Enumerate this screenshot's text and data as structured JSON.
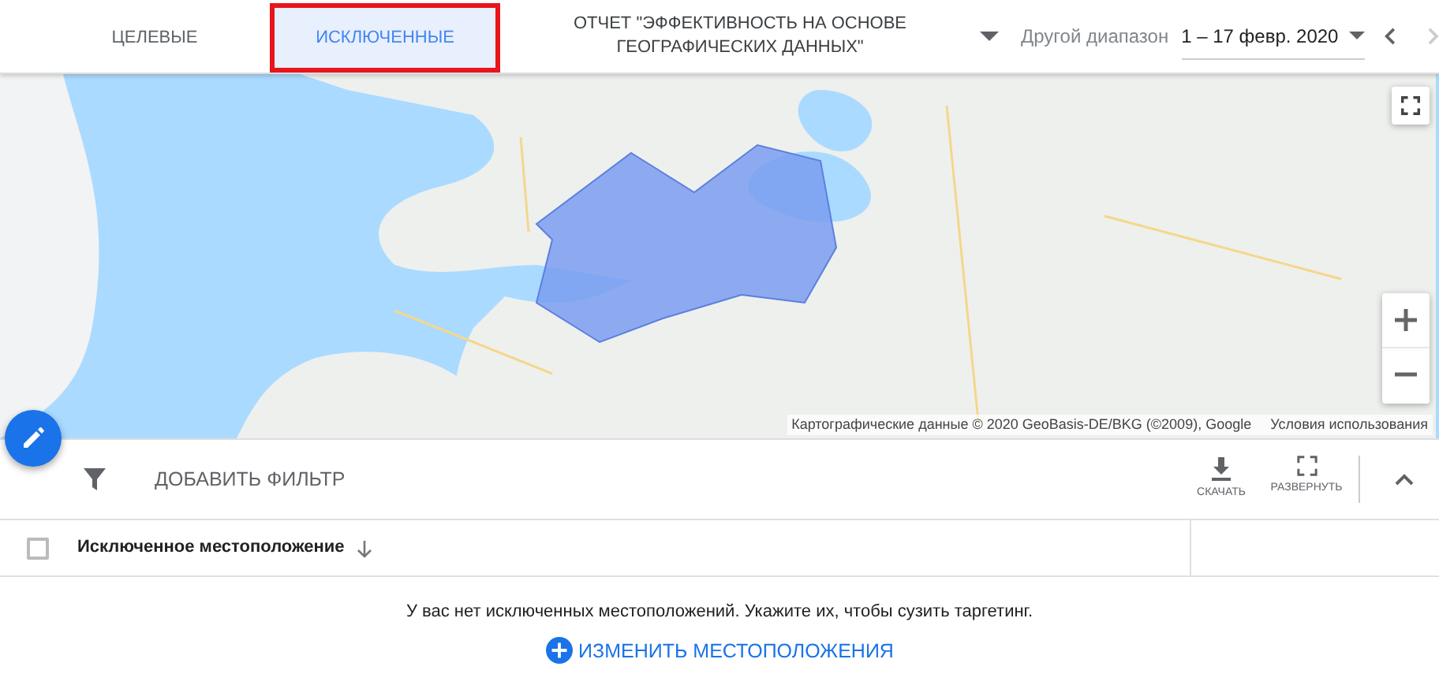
{
  "tabs": [
    {
      "label": "ЦЕЛЕВЫЕ",
      "selected": false
    },
    {
      "label": "ИСКЛЮЧЕННЫЕ",
      "selected": true
    }
  ],
  "report": {
    "label": "ОТЧЕТ \"ЭФФЕКТИВНОСТЬ НА ОСНОВЕ ГЕОГРАФИЧЕСКИХ ДАННЫХ\""
  },
  "date_range": {
    "label": "Другой диапазон",
    "value": "1 – 17 февр. 2020"
  },
  "map": {
    "attribution": "Картографические данные © 2020 GeoBasis-DE/BKG (©2009), Google",
    "terms": "Условия использования"
  },
  "filter_bar": {
    "add_filter": "ДОБАВИТЬ ФИЛЬТР",
    "actions": [
      "СКАЧАТЬ",
      "РАЗВЕРНУТЬ"
    ]
  },
  "table": {
    "select_all": {
      "checked": false
    },
    "columns": [
      "Исключенное местоположение"
    ]
  },
  "empty_state": {
    "message": "У вас нет исключенных местоположений. Укажите их, чтобы сузить таргетинг.",
    "action": "ИЗМЕНИТЬ МЕСТОПОЛОЖЕНИЯ"
  }
}
